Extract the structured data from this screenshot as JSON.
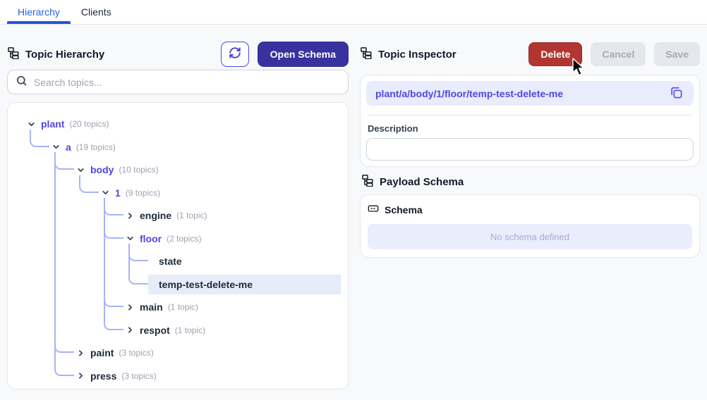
{
  "tabs": [
    {
      "label": "Hierarchy",
      "active": true
    },
    {
      "label": "Clients",
      "active": false
    }
  ],
  "left_panel": {
    "title": "Topic Hierarchy",
    "refresh_button": "refresh",
    "open_schema_label": "Open Schema",
    "search_placeholder": "Search topics...",
    "search_value": "",
    "tree": [
      {
        "label": "plant",
        "count": "(20 topics)",
        "state": "expanded",
        "children": [
          {
            "label": "a",
            "count": "(19 topics)",
            "state": "expanded",
            "children": [
              {
                "label": "body",
                "count": "(10 topics)",
                "state": "expanded",
                "children": [
                  {
                    "label": "1",
                    "count": "(9 topics)",
                    "state": "expanded",
                    "children": [
                      {
                        "label": "engine",
                        "count": "(1 topic)",
                        "state": "collapsed"
                      },
                      {
                        "label": "floor",
                        "count": "(2 topics)",
                        "state": "expanded",
                        "children": [
                          {
                            "label": "state",
                            "count": "",
                            "state": "leaf"
                          },
                          {
                            "label": "temp-test-delete-me",
                            "count": "",
                            "state": "leaf",
                            "selected": true
                          }
                        ]
                      },
                      {
                        "label": "main",
                        "count": "(1 topic)",
                        "state": "collapsed"
                      },
                      {
                        "label": "respot",
                        "count": "(1 topic)",
                        "state": "collapsed"
                      }
                    ]
                  }
                ]
              },
              {
                "label": "paint",
                "count": "(3 topics)",
                "state": "collapsed"
              },
              {
                "label": "press",
                "count": "(3 topics)",
                "state": "collapsed"
              }
            ]
          }
        ]
      }
    ]
  },
  "right_panel": {
    "title": "Topic Inspector",
    "delete_label": "Delete",
    "cancel_label": "Cancel",
    "save_label": "Save",
    "topic_path": "plant/a/body/1/floor/temp-test-delete-me",
    "description_label": "Description",
    "description_value": "",
    "payload_schema_title": "Payload Schema",
    "schema_label": "Schema",
    "no_schema_text": "No schema defined"
  },
  "icons": {
    "hierarchy": "hierarchy-icon",
    "search": "search-icon",
    "refresh": "refresh-icon",
    "copy": "copy-icon",
    "schema": "schema-icon",
    "chevron_down": "chevron-down-icon",
    "chevron_right": "chevron-right-icon",
    "cursor": "mouse-cursor"
  },
  "colors": {
    "accent_indigo": "#4f46e5",
    "open_schema_bg": "#37329e",
    "delete_red": "#b23531",
    "tab_active_blue": "#2563eb",
    "tree_line": "#a7b4f7",
    "selected_row_bg": "#e6ecfa",
    "chip_bg": "#e9ecfc",
    "no_schema_bg": "#e9edfc",
    "content_bg": "#f8f9fb"
  }
}
